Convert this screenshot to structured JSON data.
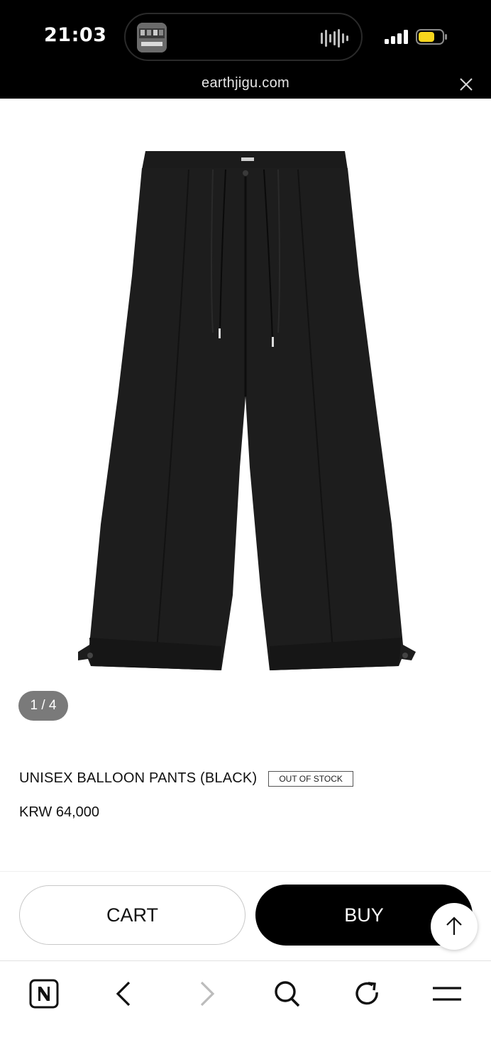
{
  "status_bar": {
    "time": "21:03",
    "url": "earthjigu.com",
    "icons": [
      "music-wave-icon",
      "signal-icon",
      "battery-icon",
      "close-icon"
    ]
  },
  "gallery": {
    "counter": "1 / 4",
    "image": "black-balloon-pants-photo"
  },
  "product": {
    "title": "UNISEX BALLOON PANTS (BLACK)",
    "badge": "OUT OF STOCK",
    "price": "KRW 64,000"
  },
  "actions": {
    "cart_label": "CART",
    "buy_label": "BUY",
    "scroll_top_icon": "arrow-up-icon"
  },
  "navbar": {
    "items": [
      "naver-icon",
      "back-icon",
      "forward-icon",
      "search-icon",
      "refresh-icon",
      "menu-icon"
    ]
  },
  "colors": {
    "buy_button": "#000000",
    "counter_pill": "#7a7a7a",
    "battery_fill": "#f7d51d"
  }
}
